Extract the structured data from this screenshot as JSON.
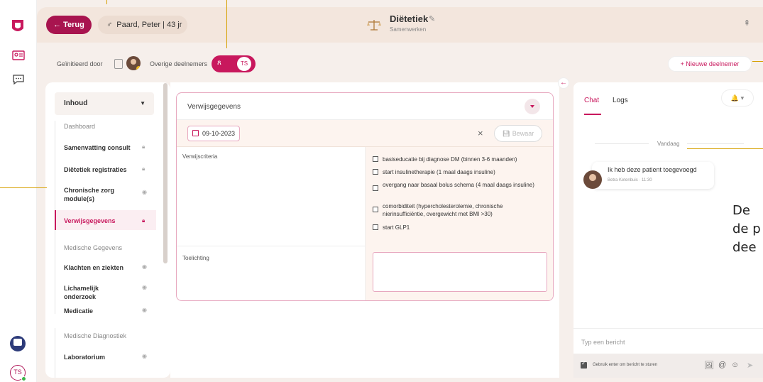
{
  "header": {
    "back_label": "← Terug",
    "patient": "Paard, Peter | 43 jr",
    "sex_symbol": "♂",
    "title": "Diëtetiek",
    "subtitle": "Samenwerken",
    "pin_icon": "pin-icon",
    "edit_icon": "pencil-icon"
  },
  "participants": {
    "initiated_by": "Geïnitieerd door",
    "other": "Overige deelnemers",
    "initials": "TS",
    "new_button": "+ Nieuwe deelnemer"
  },
  "sidebar": {
    "dropdown_label": "Inhoud",
    "sections": [
      {
        "title": "Dashboard",
        "items": [
          {
            "label": "Samenvatting consult",
            "icon": "lock-icon"
          },
          {
            "label": "Diëtetiek registraties",
            "icon": "lock-icon"
          },
          {
            "label": "Chronische zorg module(s)",
            "icon": "eye-icon"
          },
          {
            "label": "Verwijsgegevens",
            "icon": "lock-icon",
            "active": true
          }
        ]
      },
      {
        "title": "Medische Gegevens",
        "items": [
          {
            "label": "Klachten en ziekten",
            "icon": "eye-icon"
          },
          {
            "label": "Lichamelijk onderzoek",
            "icon": "eye-icon"
          },
          {
            "label": "Medicatie",
            "icon": "eye-icon"
          }
        ]
      },
      {
        "title": "Medische Diagnostiek",
        "items": [
          {
            "label": "Laboratorium",
            "icon": "eye-icon"
          }
        ]
      }
    ]
  },
  "card": {
    "title": "Verwijsgegevens",
    "date": "09-10-2023",
    "close": "×",
    "save": "Bewaar",
    "criteria_label": "Verwijscriteria",
    "criteria": [
      "basiseducatie bij diagnose DM (binnen 3-6 maanden)",
      "start insulinetherapie (1 maal daags insuline)",
      "overgang naar basaal bolus schema (4 maal daags insuline)",
      "comorbiditeit (hypercholesterolemie, chronische nierinsufficiëntie, overgewicht met BMI >30)",
      "start GLP1"
    ],
    "note_label": "Toelichting"
  },
  "chat": {
    "tab_chat": "Chat",
    "tab_logs": "Logs",
    "bell": "🔔 ▾",
    "day": "Vandaag",
    "message": "Ik heb deze patient toegevoegd",
    "sender": "Betra Ketenbuis · 11:30",
    "input_placeholder": "Typ een bericht",
    "enter_option": "Gebruik enter om bericht te sturen",
    "icons": [
      "image-icon",
      "at-icon",
      "emoji-icon",
      "send-icon"
    ]
  },
  "overlay": {
    "line1": "De",
    "line2": "de p",
    "line3": "dee"
  },
  "colors": {
    "accent": "#c8185d",
    "dark_accent": "#a8144f",
    "callout": "#d6a000"
  }
}
